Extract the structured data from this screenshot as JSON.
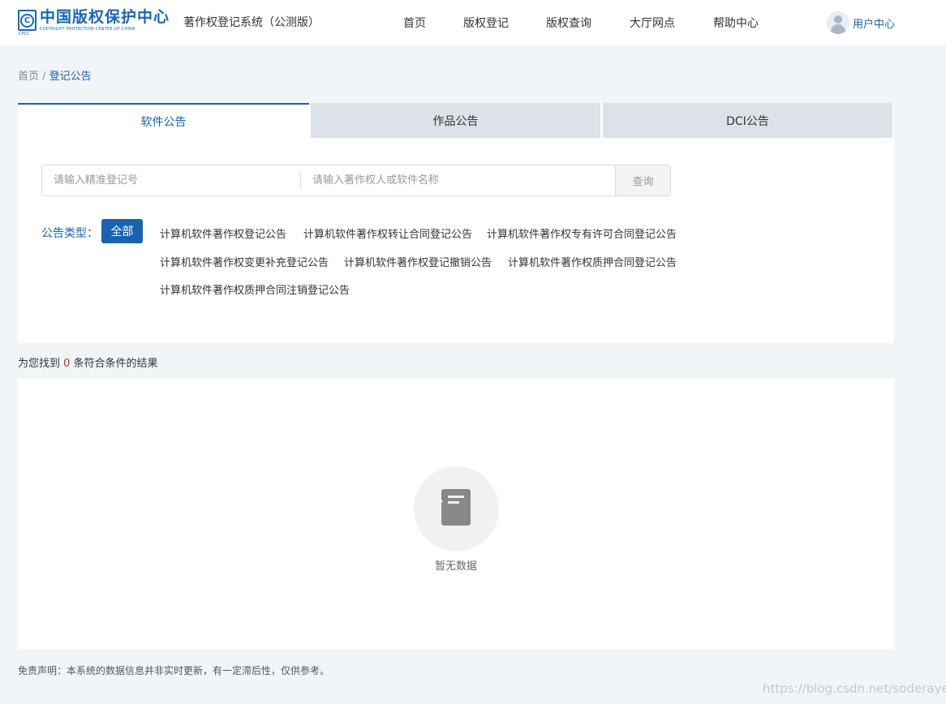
{
  "header": {
    "logo_cn": "中国版权保护中心",
    "logo_en": "COPYRIGHT PROTECTION CENTER OF CHINA",
    "logo_mark": "CPCC",
    "system_title": "著作权登记系统（公测版）",
    "nav": [
      "首页",
      "版权登记",
      "版权查询",
      "大厅网点",
      "帮助中心"
    ],
    "user_label": "用户中心"
  },
  "breadcrumb": {
    "home": "首页",
    "separator": " / ",
    "current": "登记公告"
  },
  "tabs": [
    "软件公告",
    "作品公告",
    "DCI公告"
  ],
  "search": {
    "reg_no_placeholder": "请输入精准登记号",
    "name_placeholder": "请输入著作权人或软件名称",
    "button": "查询"
  },
  "filter": {
    "label": "公告类型：",
    "all": "全部",
    "types": [
      "计算机软件著作权登记公告",
      "计算机软件著作权转让合同登记公告",
      "计算机软件著作权专有许可合同登记公告",
      "计算机软件著作权变更补充登记公告",
      "计算机软件著作权登记撤销公告",
      "计算机软件著作权质押合同登记公告",
      "计算机软件著作权质押合同注销登记公告"
    ]
  },
  "result": {
    "prefix": "为您找到 ",
    "count": "0",
    "suffix": " 条符合条件的结果"
  },
  "empty": {
    "icon": "document-search-icon",
    "text": "暂无数据"
  },
  "disclaimer": "免责声明：本系统的数据信息并非实时更新，有一定滞后性，仅供参考。",
  "watermark": "https://blog.csdn.net/soderayer",
  "colors": {
    "primary": "#1664b0",
    "background": "#f2f5f8",
    "highlight": "#e02020"
  }
}
